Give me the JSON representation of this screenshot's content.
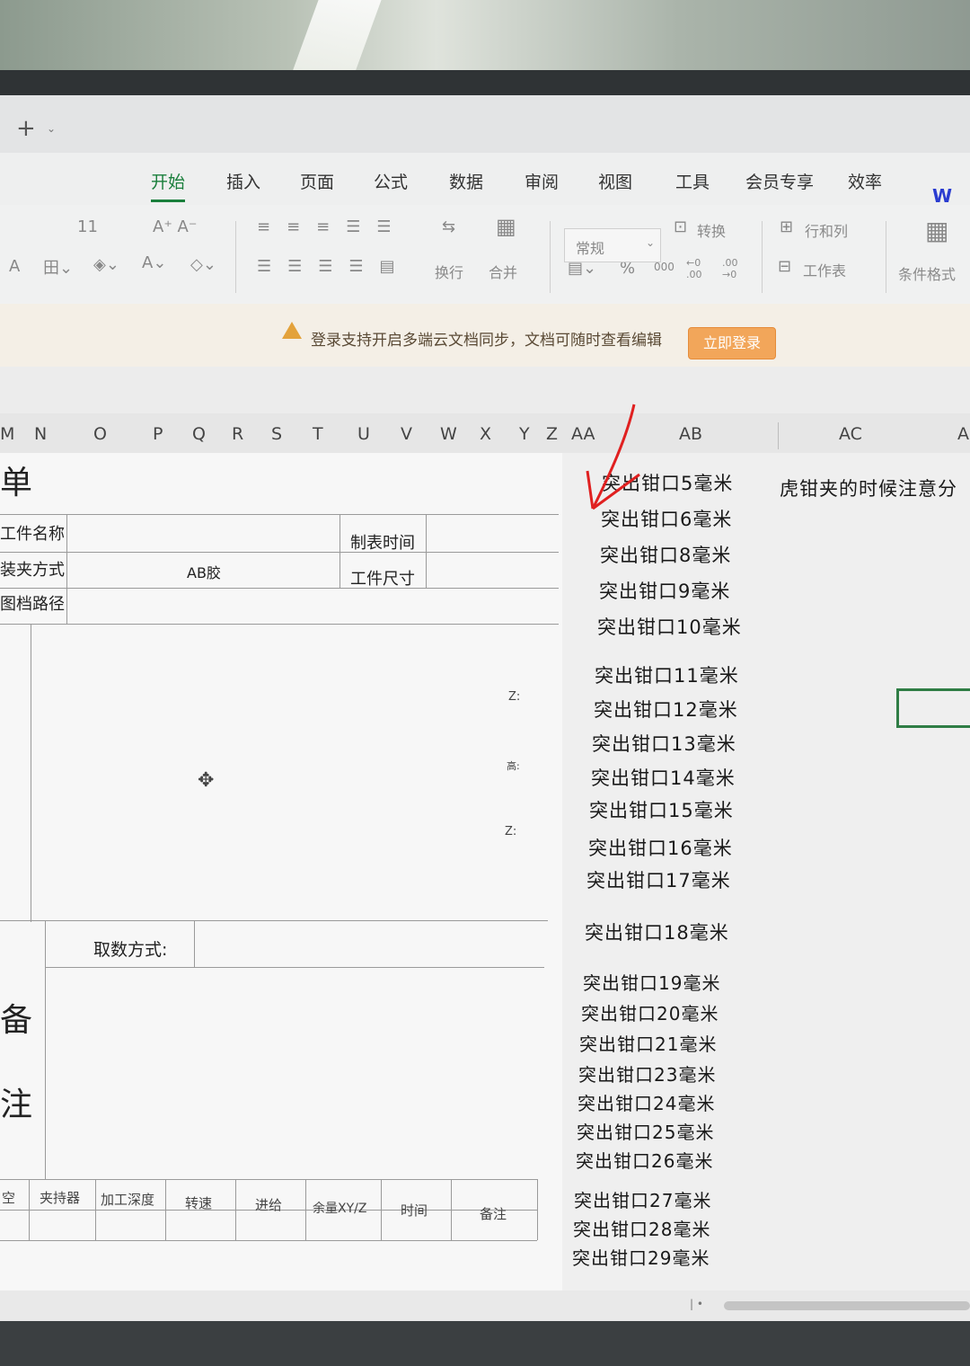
{
  "window": {
    "new_tab_symbol": "+",
    "new_tab_chevron": "⌄"
  },
  "ribbon": {
    "tabs": [
      "开始",
      "插入",
      "页面",
      "公式",
      "数据",
      "审阅",
      "视图",
      "工具",
      "会员专享",
      "效率"
    ],
    "active_tab": "开始",
    "logo_text": "W"
  },
  "toolbar": {
    "number_format": "常规",
    "convert_label": "转换",
    "row_col_label": "行和列",
    "worksheet_label": "工作表",
    "conditional_format_label": "条件格式",
    "wrap_label": "换行",
    "merge_label": "合并",
    "percent_symbol": "%",
    "thousands": "000",
    "dec_inc": "←0 .00",
    "dec_dec": ".00 →0"
  },
  "banner": {
    "message": "登录支持开启多端云文档同步，文档可随时查看编辑",
    "login_button": "立即登录"
  },
  "columns": [
    "M",
    "N",
    "O",
    "P",
    "Q",
    "R",
    "S",
    "T",
    "U",
    "V",
    "W",
    "X",
    "Y",
    "Z",
    "AA",
    "AB",
    "AC",
    "A"
  ],
  "form": {
    "title_fragment": "单",
    "part_name_label": "工件名称",
    "clamp_method_label": "装夹方式",
    "clamp_method_value": "AB胶",
    "drawing_path_label": "图档路径",
    "table_time_label": "制表时间",
    "part_size_label": "工件尺寸",
    "z_label_1": "Z:",
    "height_label": "高:",
    "z_label_2": "Z:",
    "measure_method_label": "取数方式:",
    "remark_char_1": "备",
    "remark_char_2": "注",
    "table_headers": [
      "空",
      "夹持器",
      "加工深度",
      "转速",
      "进给",
      "余量XY/Z",
      "时间",
      "备注"
    ]
  },
  "notes": {
    "ab_column": [
      "突出钳口5毫米",
      "突出钳口6毫米",
      "突出钳口8毫米",
      "突出钳口9毫米",
      "突出钳口10毫米",
      "突出钳口11毫米",
      "突出钳口12毫米",
      "突出钳口13毫米",
      "突出钳口14毫米",
      "突出钳口15毫米",
      "突出钳口16毫米",
      "突出钳口17毫米",
      "突出钳口18毫米",
      "突出钳口19毫米",
      "突出钳口20毫米",
      "突出钳口21毫米",
      "突出钳口23毫米",
      "突出钳口24毫米",
      "突出钳口25毫米",
      "突出钳口26毫米",
      "突出钳口27毫米",
      "突出钳口28毫米",
      "突出钳口29毫米"
    ],
    "ac_column": "虎钳夹的时候注意分"
  },
  "colors": {
    "accent_green": "#1a7f3c",
    "annotation_red": "#e02020",
    "login_orange": "#f2a65a"
  },
  "icons": [
    "warning-icon",
    "plus-icon",
    "move-cursor-icon",
    "red-arrow-annotation"
  ]
}
